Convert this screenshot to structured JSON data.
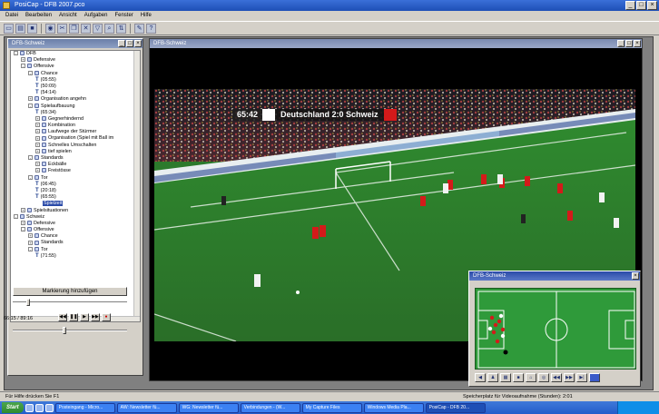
{
  "app": {
    "title": "PosiCap - DFB 2007.pco"
  },
  "menu": [
    "Datei",
    "Bearbeiten",
    "Ansicht",
    "Aufgaben",
    "Fenster",
    "Hilfe"
  ],
  "tree_window": {
    "title": "DFB-Schweiz"
  },
  "tree": [
    {
      "indent": 0,
      "exp": "-",
      "icon": "box",
      "label": "DFB"
    },
    {
      "indent": 1,
      "exp": "+",
      "icon": "box",
      "label": "Defensive"
    },
    {
      "indent": 1,
      "exp": "-",
      "icon": "box",
      "label": "Offensive"
    },
    {
      "indent": 2,
      "exp": "-",
      "icon": "box",
      "label": "Chance"
    },
    {
      "indent": 3,
      "exp": "",
      "icon": "t",
      "label": "(05:55)"
    },
    {
      "indent": 3,
      "exp": "",
      "icon": "t",
      "label": "(50:09)"
    },
    {
      "indent": 3,
      "exp": "",
      "icon": "t",
      "label": "(54:14)"
    },
    {
      "indent": 2,
      "exp": "+",
      "icon": "box",
      "label": "Organisation angehn"
    },
    {
      "indent": 2,
      "exp": "-",
      "icon": "box",
      "label": "Spielaufbauung"
    },
    {
      "indent": 3,
      "exp": "",
      "icon": "t",
      "label": "(65:34)"
    },
    {
      "indent": 3,
      "exp": "+",
      "icon": "box",
      "label": "Gegnerhindernd"
    },
    {
      "indent": 3,
      "exp": "+",
      "icon": "box",
      "label": "Kombination"
    },
    {
      "indent": 3,
      "exp": "+",
      "icon": "box",
      "label": "Laufwege der Stürmer"
    },
    {
      "indent": 3,
      "exp": "+",
      "icon": "box",
      "label": "Organisation (Spiel mit Ball im"
    },
    {
      "indent": 3,
      "exp": "+",
      "icon": "box",
      "label": "Schnelles Umschalten"
    },
    {
      "indent": 3,
      "exp": "+",
      "icon": "box",
      "label": "tief spielen"
    },
    {
      "indent": 2,
      "exp": "-",
      "icon": "box",
      "label": "Standards"
    },
    {
      "indent": 3,
      "exp": "+",
      "icon": "box",
      "label": "Eckbälle"
    },
    {
      "indent": 3,
      "exp": "+",
      "icon": "box",
      "label": "Freistösse"
    },
    {
      "indent": 2,
      "exp": "-",
      "icon": "box",
      "label": "Tor"
    },
    {
      "indent": 3,
      "exp": "",
      "icon": "t",
      "label": "(06:45)"
    },
    {
      "indent": 3,
      "exp": "",
      "icon": "t",
      "label": "(20:18)"
    },
    {
      "indent": 3,
      "exp": "",
      "icon": "t",
      "label": "(65:55)"
    },
    {
      "indent": 4,
      "exp": "",
      "icon": "none",
      "label": "Spielzeit",
      "selected": true
    },
    {
      "indent": 1,
      "exp": "+",
      "icon": "box",
      "label": "Spielsituationen"
    },
    {
      "indent": 0,
      "exp": "-",
      "icon": "box",
      "label": "Schweiz"
    },
    {
      "indent": 1,
      "exp": "+",
      "icon": "box",
      "label": "Defensive"
    },
    {
      "indent": 1,
      "exp": "-",
      "icon": "box",
      "label": "Offensive"
    },
    {
      "indent": 2,
      "exp": "+",
      "icon": "box",
      "label": "Chance"
    },
    {
      "indent": 2,
      "exp": "+",
      "icon": "box",
      "label": "Standards"
    },
    {
      "indent": 2,
      "exp": "-",
      "icon": "box",
      "label": "Tor"
    },
    {
      "indent": 3,
      "exp": "",
      "icon": "t",
      "label": "(71:55)"
    }
  ],
  "controls": {
    "mark_button": "Markierung hinzufügen",
    "timecode": "66:15 / 89:16",
    "slider1_position": 0.12,
    "slider2_position": 0.45
  },
  "video_window": {
    "title": "DFB-Schweiz"
  },
  "scoreboard": {
    "time": "65:42",
    "match": "Deutschland 2:0 Schweiz"
  },
  "minimap": {
    "title": "DFB-Schweiz"
  },
  "status": {
    "left": "Für Hilfe drücken Sie F1",
    "middle": "Speicherplatz für Videoaufnahme (Stunden): 2:01"
  },
  "taskbar": {
    "start": "Start",
    "tasks": [
      "Posteingang - Micro...",
      "AW: Newsletter fü...",
      "WG: Newsletter fü...",
      "Verbindungen - (W...",
      "My Capture Files",
      "Windows Media Pla...",
      "PosiCap - DFB 20..."
    ]
  },
  "colors": {
    "pitch": "#2c7a2c",
    "home_team": "#ffffff",
    "away_team": "#d41a1a"
  }
}
